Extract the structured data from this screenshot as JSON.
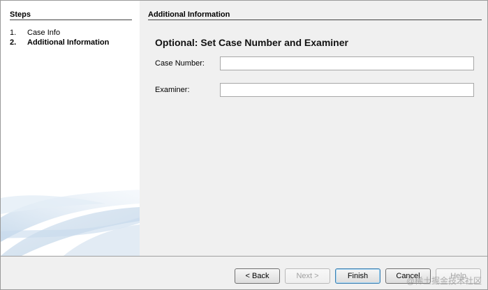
{
  "steps": {
    "title": "Steps",
    "items": [
      {
        "num": "1.",
        "label": "Case Info",
        "active": false
      },
      {
        "num": "2.",
        "label": "Additional Information",
        "active": true
      }
    ]
  },
  "content": {
    "header": "Additional Information",
    "heading": "Optional: Set Case Number and Examiner",
    "case_number": {
      "label": "Case Number:",
      "value": "",
      "placeholder": ""
    },
    "examiner": {
      "label": "Examiner:",
      "value": "",
      "placeholder": ""
    }
  },
  "buttons": {
    "back": "< Back",
    "next": "Next >",
    "finish": "Finish",
    "cancel": "Cancel",
    "help": "Help"
  },
  "watermark": "@稀土掘金技术社区",
  "colors": {
    "pane_background": "#f0f0f0",
    "steps_background": "#ffffff",
    "swirl_blue": "#cfe0ef"
  }
}
